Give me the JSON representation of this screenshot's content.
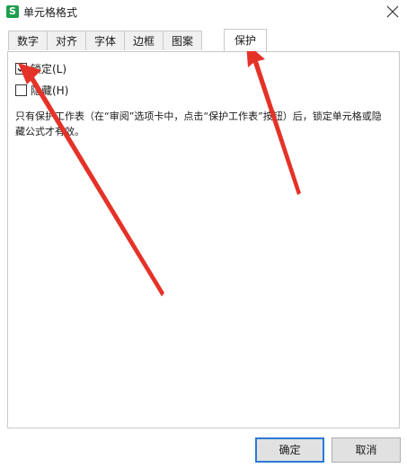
{
  "window": {
    "title": "单元格格式",
    "app_icon_glyph": "S"
  },
  "tabs": [
    {
      "label": "数字",
      "active": false
    },
    {
      "label": "对齐",
      "active": false
    },
    {
      "label": "字体",
      "active": false
    },
    {
      "label": "边框",
      "active": false
    },
    {
      "label": "图案",
      "active": false
    },
    {
      "label": "保护",
      "active": true
    }
  ],
  "protection": {
    "locked_label": "锁定(L)",
    "locked_checked": true,
    "hidden_label": "隐藏(H)",
    "hidden_checked": false,
    "description": "只有保护工作表（在“审阅”选项卡中，点击“保护工作表”按钮）后，锁定单元格或隐藏公式才有效。"
  },
  "buttons": {
    "ok_label": "确定",
    "cancel_label": "取消"
  },
  "colors": {
    "app_icon": "#1e9e4e",
    "primary_border": "#2b79d6",
    "annotation_arrow": "#e53228"
  }
}
